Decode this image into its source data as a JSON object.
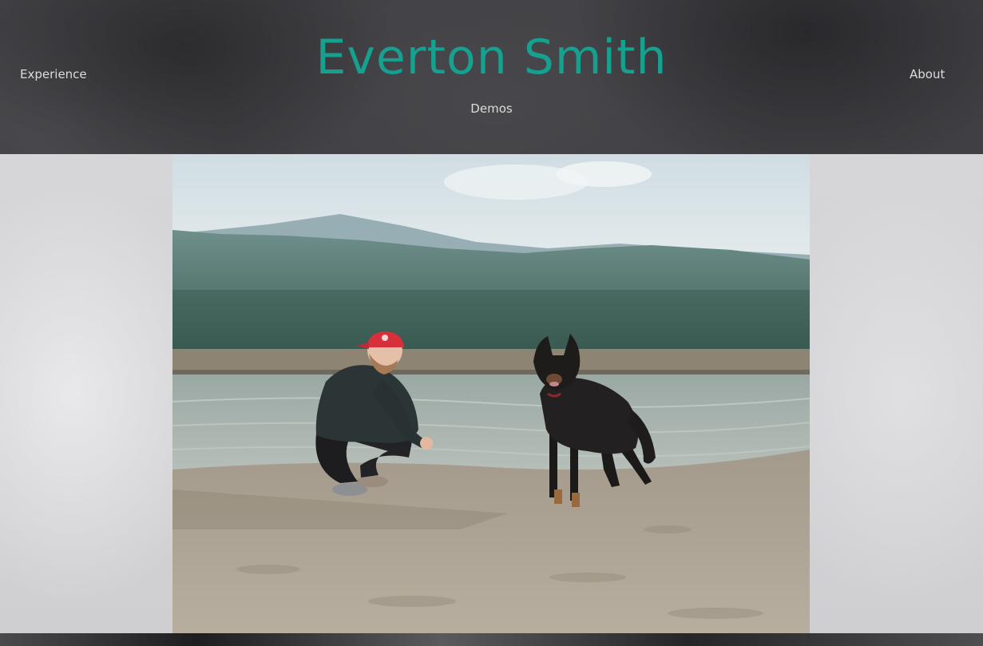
{
  "header": {
    "title": "Everton Smith",
    "nav": {
      "experience": "Experience",
      "about": "About",
      "demos": "Demos"
    }
  },
  "main": {
    "photo_alt": "Man in red cap crouching next to a black dog on a sandy lakeshore with forested mountains behind"
  },
  "colors": {
    "title": "#15a08f",
    "nav_text": "#dcdcdc",
    "header_bg": "#3a3a3e"
  }
}
